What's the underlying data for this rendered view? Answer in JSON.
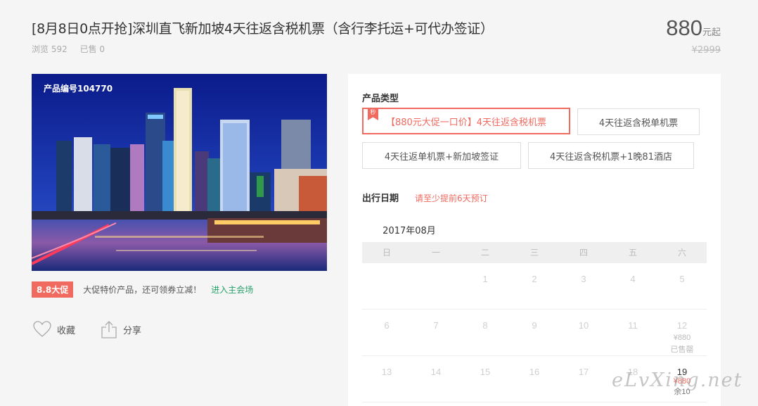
{
  "product": {
    "title": "[8月8日0点开抢]深圳直飞新加坡4天往返含税机票（含行李托运+可代办签证）",
    "views_label": "浏览 592",
    "sold_label": "已售 0",
    "price": "880",
    "price_unit": "元起",
    "original_price": "¥2999",
    "code_label": "产品编号104770"
  },
  "promo": {
    "badge": "8.8大促",
    "text": "大促特价产品，还可领券立减！",
    "link": "进入主会场"
  },
  "actions": {
    "favorite": "收藏",
    "share": "分享"
  },
  "panel": {
    "type_label": "产品类型",
    "options": [
      {
        "label": "【880元大促一口价】4天往返含税机票",
        "flag": "秒"
      },
      {
        "label": "4天往返含税单机票"
      },
      {
        "label": "4天往返单机票+新加坡签证"
      },
      {
        "label": "4天往返含税机票+1晚81酒店"
      }
    ],
    "date_label": "出行日期",
    "date_hint": "请至少提前6天预订",
    "month": "2017年08月",
    "weekdays": [
      "日",
      "一",
      "二",
      "三",
      "四",
      "五",
      "六"
    ],
    "weeks": [
      [
        {
          "d": ""
        },
        {
          "d": ""
        },
        {
          "d": "1"
        },
        {
          "d": "2"
        },
        {
          "d": "3"
        },
        {
          "d": "4"
        },
        {
          "d": "5"
        }
      ],
      [
        {
          "d": "6"
        },
        {
          "d": "7"
        },
        {
          "d": "8"
        },
        {
          "d": "9"
        },
        {
          "d": "10"
        },
        {
          "d": "11"
        },
        {
          "d": "12",
          "price": "¥880",
          "status": "已售罄"
        }
      ],
      [
        {
          "d": "13"
        },
        {
          "d": "14"
        },
        {
          "d": "15"
        },
        {
          "d": "16"
        },
        {
          "d": "17"
        },
        {
          "d": "18"
        },
        {
          "d": "19",
          "price": "¥880",
          "status": "余10",
          "available": true
        }
      ]
    ]
  },
  "watermark": "eLvXing.net",
  "colors": {
    "accent": "#f06a5f",
    "link": "#29a06a",
    "background": "#f5f5f5"
  }
}
